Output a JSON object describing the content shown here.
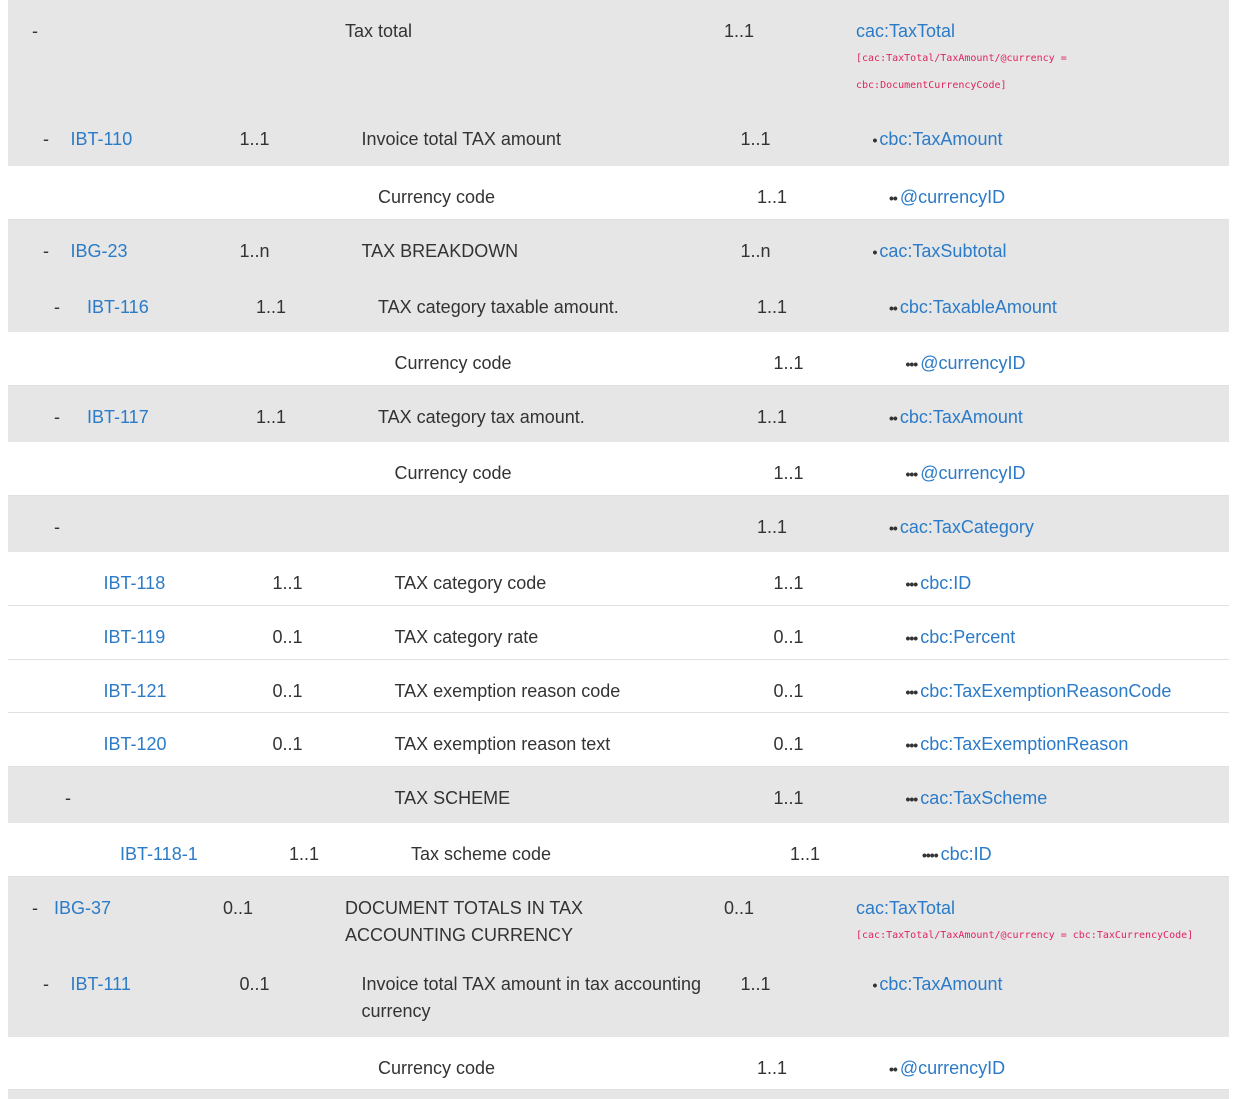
{
  "rows": [
    {
      "dash": "-",
      "id": "",
      "card": "",
      "name": "Tax total",
      "card2": "1..1",
      "dots": "",
      "path": "cac:TaxTotal",
      "rule": [
        "[cac:TaxTotal/TaxAmount/@currency =",
        "cbc:DocumentCurrencyCode]"
      ]
    },
    {
      "dash": "-",
      "id": "IBT-110",
      "card": "1..1",
      "name": "Invoice total TAX amount",
      "card2": "1..1",
      "dots": "•",
      "path": "cbc:TaxAmount"
    },
    {
      "dash": "",
      "id": "",
      "card": "",
      "name": "Currency code",
      "card2": "1..1",
      "dots": "••",
      "path": "@currencyID"
    },
    {
      "dash": "-",
      "id": "IBG-23",
      "card": "1..n",
      "name": "TAX BREAKDOWN",
      "card2": "1..n",
      "dots": "•",
      "path": "cac:TaxSubtotal"
    },
    {
      "dash": "-",
      "id": "IBT-116",
      "card": "1..1",
      "name": "TAX category taxable amount.",
      "card2": "1..1",
      "dots": "••",
      "path": "cbc:TaxableAmount"
    },
    {
      "dash": "",
      "id": "",
      "card": "",
      "name": "Currency code",
      "card2": "1..1",
      "dots": "•••",
      "path": "@currencyID"
    },
    {
      "dash": "-",
      "id": "IBT-117",
      "card": "1..1",
      "name": "TAX category tax amount.",
      "card2": "1..1",
      "dots": "••",
      "path": "cbc:TaxAmount"
    },
    {
      "dash": "",
      "id": "",
      "card": "",
      "name": "Currency code",
      "card2": "1..1",
      "dots": "•••",
      "path": "@currencyID"
    },
    {
      "dash": "-",
      "id": "",
      "card": "",
      "name": "",
      "card2": "1..1",
      "dots": "••",
      "path": "cac:TaxCategory"
    },
    {
      "dash": "",
      "id": "IBT-118",
      "card": "1..1",
      "name": "TAX category code",
      "card2": "1..1",
      "dots": "•••",
      "path": "cbc:ID"
    },
    {
      "dash": "",
      "id": "IBT-119",
      "card": "0..1",
      "name": "TAX category rate",
      "card2": "0..1",
      "dots": "•••",
      "path": "cbc:Percent"
    },
    {
      "dash": "",
      "id": "IBT-121",
      "card": "0..1",
      "name": "TAX exemption reason code",
      "card2": "0..1",
      "dots": "•••",
      "path": "cbc:TaxExemptionReasonCode"
    },
    {
      "dash": "",
      "id": "IBT-120",
      "card": "0..1",
      "name": "TAX exemption reason text",
      "card2": "0..1",
      "dots": "•••",
      "path": "cbc:TaxExemptionReason"
    },
    {
      "dash": "-",
      "id": "",
      "card": "",
      "name": "TAX SCHEME",
      "card2": "1..1",
      "dots": "•••",
      "path": "cac:TaxScheme"
    },
    {
      "dash": "",
      "id": "IBT-118-1",
      "card": "1..1",
      "name": "Tax scheme code",
      "card2": "1..1",
      "dots": "••••",
      "path": "cbc:ID"
    },
    {
      "dash": "-",
      "id": "IBG-37",
      "card": "0..1",
      "name": "DOCUMENT TOTALS IN TAX ACCOUNTING CURRENCY",
      "card2": "0..1",
      "dots": "",
      "path": "cac:TaxTotal",
      "rule": [
        "[cac:TaxTotal/TaxAmount/@currency = cbc:TaxCurrencyCode]"
      ]
    },
    {
      "dash": "-",
      "id": "IBT-111",
      "card": "0..1",
      "name": "Invoice total TAX amount in tax accounting currency",
      "card2": "1..1",
      "dots": "•",
      "path": "cbc:TaxAmount"
    },
    {
      "dash": "",
      "id": "",
      "card": "",
      "name": "Currency code",
      "card2": "1..1",
      "dots": "••",
      "path": "@currencyID"
    }
  ]
}
